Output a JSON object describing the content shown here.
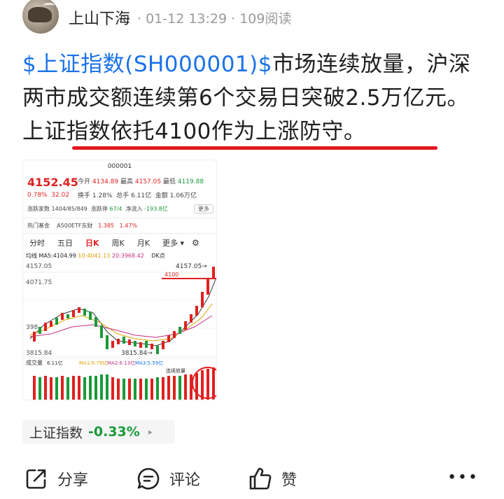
{
  "header": {
    "author": "上山下海",
    "meta": "· 01-12 13:29 · 109阅读"
  },
  "post": {
    "stock_link": "$上证指数(SH000001)$",
    "text_1": "市场连续放量，沪深两市成交额连续第6个交易日突破2.5万亿元。",
    "text_2": "上证指数依托4100作为上涨防守。"
  },
  "card": {
    "code": "000001",
    "price": "4152.45",
    "change_pct": "0.78%",
    "change_val": "32.02",
    "quote_row1": [
      "今开",
      "4134.89",
      "最高",
      "4157.05",
      "最低",
      "4119.88"
    ],
    "quote_row2": [
      "换手",
      "1.28%",
      "总手",
      "6.11亿",
      "金额",
      "1.06万亿"
    ],
    "quote_row3": [
      "涨跌家数",
      "1404/85/849",
      "涨跌停",
      "67/4",
      "净流入",
      "-193.8亿"
    ],
    "more": "更多",
    "fund_row": [
      "热门基金",
      "A500ETF东财",
      "1.385",
      "1.47%"
    ],
    "tabs": [
      "分时",
      "五日",
      "日K",
      "周K",
      "月K",
      "更多 ▾"
    ],
    "ma_line": [
      "均线",
      "MA5:4104.99",
      "10:4041.13",
      "20:3968.42"
    ],
    "dk": "DK点",
    "y_top": "4157.05",
    "y_mid": "4071.75",
    "y_low1": "398",
    "y_low2": "3815.84",
    "hi_label": "4157.05→",
    "line_label": "4100",
    "low_label": "3815.84→",
    "volume_label": "成交量",
    "volume_vals": [
      "6.11亿",
      "MA1:6.79亿",
      "MA2:6.13亿",
      "MA3:5.59亿"
    ],
    "volume_note": "连续放量",
    "chart_data": {
      "type": "candlestick",
      "title": "",
      "y_axis_ticks": [
        "4157.05",
        "4071.75",
        "3815.84"
      ],
      "marked_levels": [
        4100
      ],
      "high": 4157.05,
      "low": 3815.84
    }
  },
  "chip": {
    "name": "上证指数",
    "pct": "-0.33%",
    "arrow": "▸"
  },
  "actions": {
    "share": "分享",
    "comment": "评论",
    "like": "赞",
    "more": "•••"
  },
  "colors": {
    "link": "#1a72e8",
    "up": "#e02020",
    "down": "#1a9a3a",
    "underline": "#e0191e"
  }
}
